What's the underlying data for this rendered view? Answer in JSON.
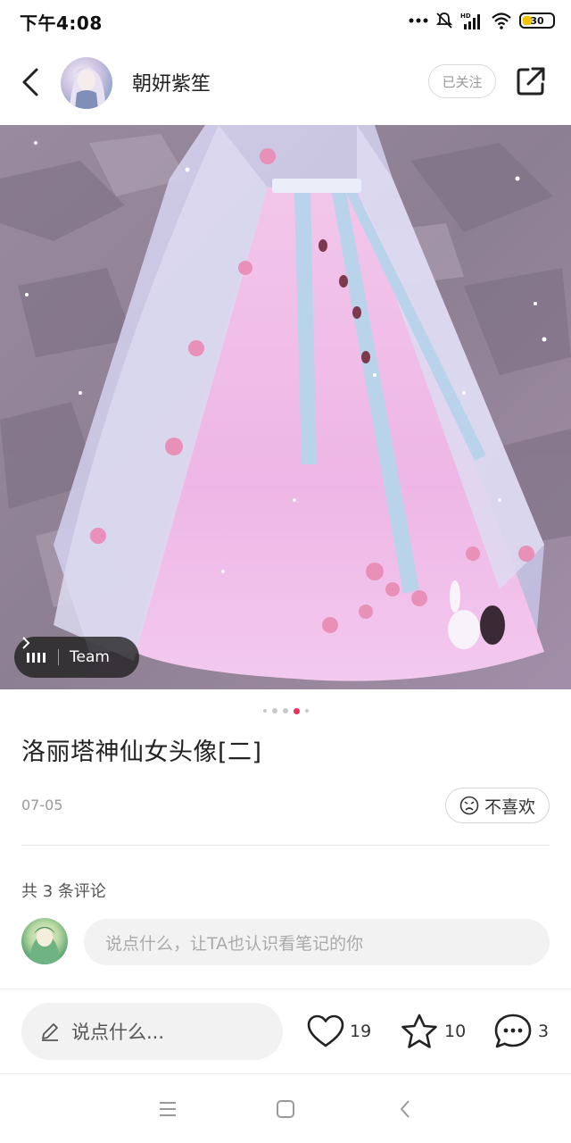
{
  "status_bar": {
    "time": "下午4:08",
    "network": "HD",
    "battery": "30"
  },
  "header": {
    "author_name": "朝妍紫笙",
    "follow_label": "已关注"
  },
  "photo": {
    "team_label": "Team",
    "page_count": 5,
    "active_page": 4
  },
  "note": {
    "title": "洛丽塔神仙女头像[二]",
    "date": "07-05",
    "dislike_label": "不喜欢"
  },
  "comments": {
    "count_text": "共 3 条评论",
    "input_placeholder": "说点什么，让TA也认识看笔记的你"
  },
  "bottom_bar": {
    "say_placeholder": "说点什么...",
    "likes": "19",
    "collects": "10",
    "comments": "3"
  },
  "colors": {
    "accent": "#e8325a",
    "text": "#222222",
    "muted": "#999999"
  },
  "icons": [
    "back-icon",
    "share-icon",
    "heart-icon",
    "star-icon",
    "comment-bubble-icon",
    "pencil-icon",
    "dislike-face-icon",
    "menu-nav-icon",
    "home-nav-icon",
    "back-nav-icon"
  ]
}
